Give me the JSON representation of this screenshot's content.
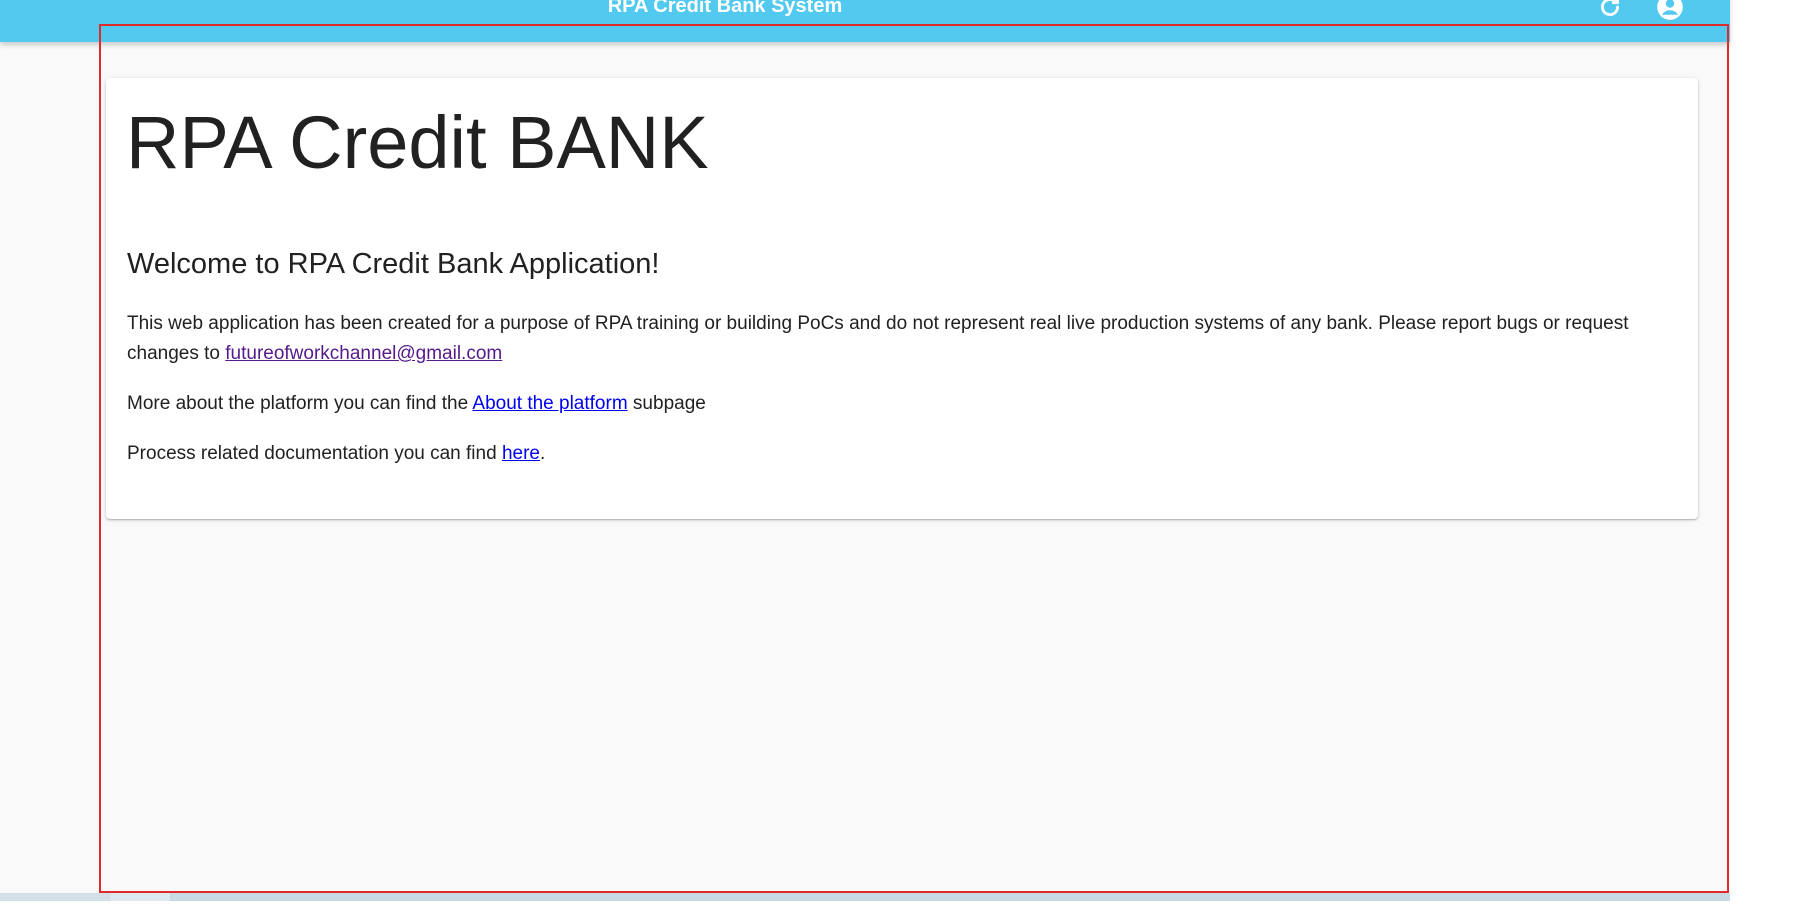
{
  "app_bar": {
    "title": "RPA Credit Bank System",
    "icons": [
      "refresh-icon",
      "account-circle-icon"
    ],
    "color": "#52c9ef"
  },
  "card": {
    "title": "RPA Credit BANK",
    "heading": "Welcome to RPA Credit Bank Application!",
    "intro_text": "This web application has been created for a purpose of RPA training or building PoCs and do not represent real live production systems of any bank. Please report bugs or request changes to ",
    "email_link": "futureofworkchannel@gmail.com",
    "about_prefix": "More about the platform you can find the ",
    "about_link": "About the platform",
    "about_suffix": " subpage",
    "docs_prefix": "Process related documentation you can find ",
    "docs_link": "here",
    "docs_suffix": "."
  },
  "colors": {
    "page_background": "#f9f9f9",
    "link": "#0000ee",
    "visited_link": "#551a8b",
    "selection_frame": "#e02b2b"
  }
}
